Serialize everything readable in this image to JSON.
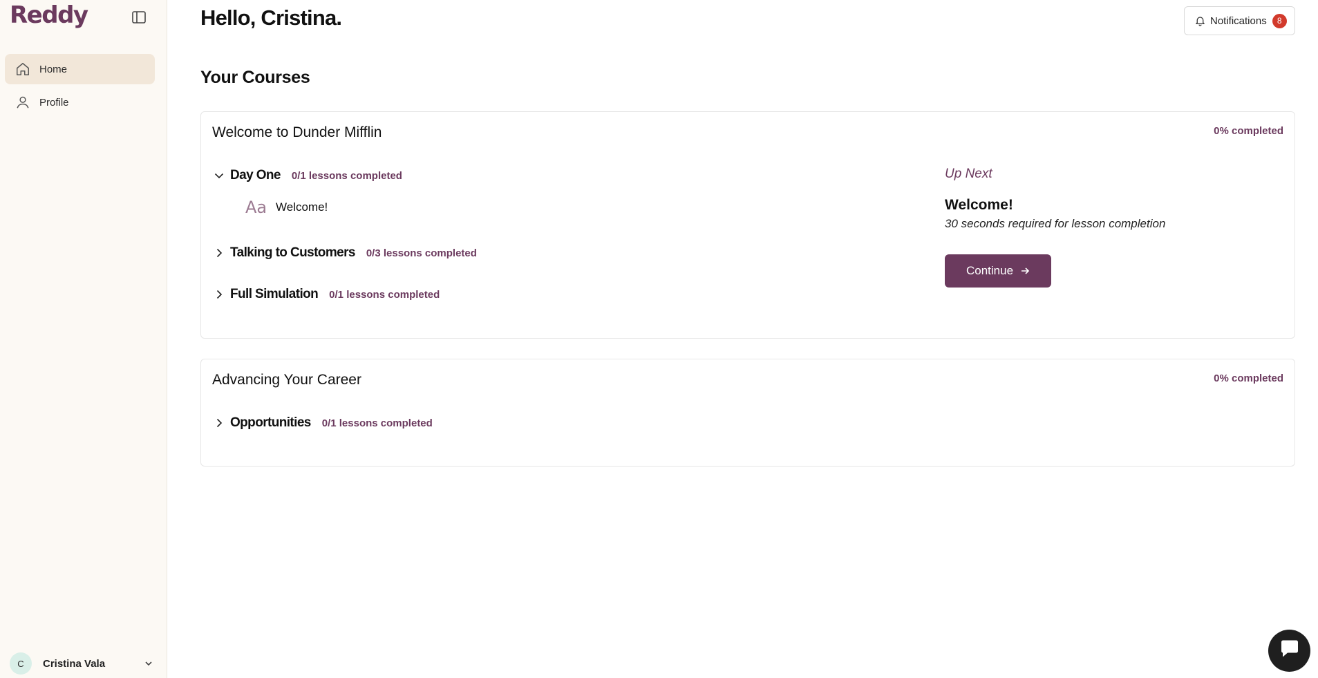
{
  "app": {
    "logo": "Reddy"
  },
  "sidebar": {
    "items": [
      {
        "label": "Home",
        "icon": "home-icon",
        "active": true
      },
      {
        "label": "Profile",
        "icon": "user-icon",
        "active": false
      }
    ],
    "user": {
      "initial": "C",
      "name": "Cristina Vala"
    }
  },
  "header": {
    "greeting": "Hello, Cristina.",
    "notifications": {
      "label": "Notifications",
      "count": "8"
    }
  },
  "main": {
    "section_title": "Your Courses",
    "courses": [
      {
        "title": "Welcome to Dunder Mifflin",
        "progress": "0% completed",
        "modules": [
          {
            "name": "Day One",
            "count": "0/1 lessons completed",
            "expanded": true,
            "lessons": [
              {
                "icon": "text-lesson-icon",
                "title": "Welcome!"
              }
            ]
          },
          {
            "name": "Talking to Customers",
            "count": "0/3 lessons completed",
            "expanded": false
          },
          {
            "name": "Full Simulation",
            "count": "0/1 lessons completed",
            "expanded": false
          }
        ],
        "up_next": {
          "label": "Up Next",
          "title": "Welcome!",
          "requirement": "30 seconds required for lesson completion",
          "button": "Continue"
        }
      },
      {
        "title": "Advancing Your Career",
        "progress": "0% completed",
        "modules": [
          {
            "name": "Opportunities",
            "count": "0/1 lessons completed",
            "expanded": false
          }
        ]
      }
    ]
  },
  "colors": {
    "brand": "#6b3a5e",
    "sidebar_bg": "#fcf9f4",
    "active_nav": "#f2e7d9",
    "badge": "#d23a2c"
  }
}
